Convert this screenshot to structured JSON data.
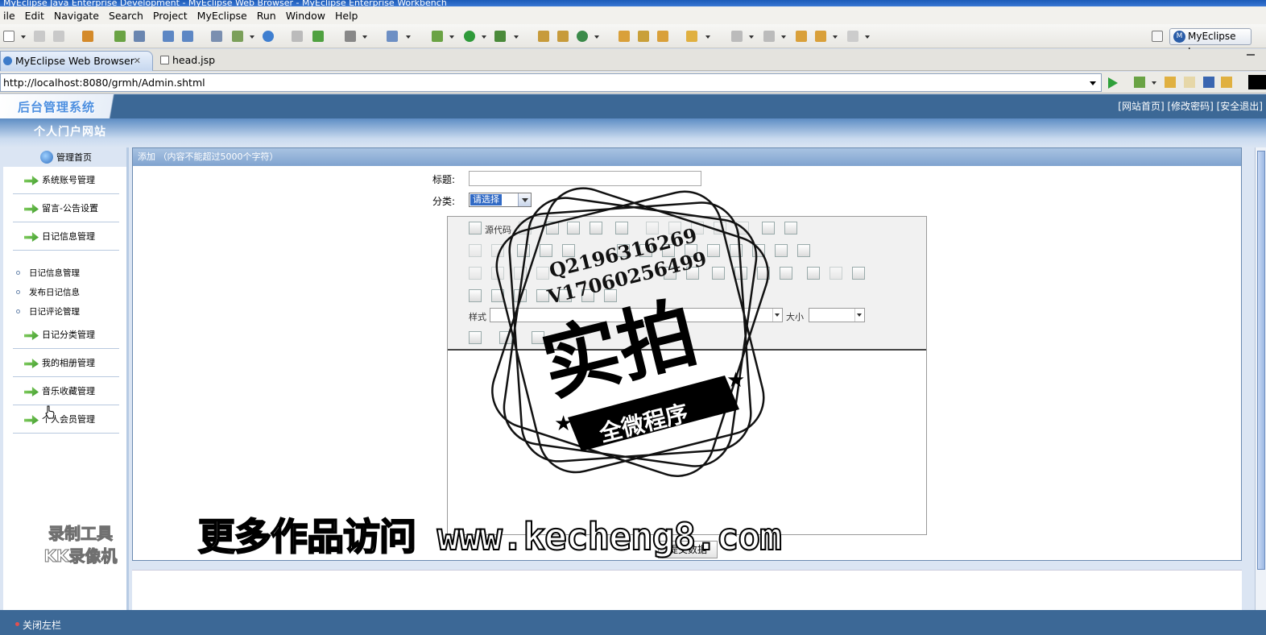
{
  "window": {
    "title": "MyEclipse Java Enterprise Development - MyEclipse Web Browser - MyEclipse Enterprise Workbench"
  },
  "menu": [
    "ile",
    "Edit",
    "Navigate",
    "Search",
    "Project",
    "MyEclipse",
    "Run",
    "Window",
    "Help"
  ],
  "perspective": {
    "label": "MyEclipse J..."
  },
  "tabs": [
    {
      "label": "MyEclipse Web Browser",
      "active": true
    },
    {
      "label": "head.jsp",
      "active": false
    }
  ],
  "address": {
    "url": "http://localhost:8080/grmh/Admin.shtml"
  },
  "site": {
    "logo": "后台管理系统",
    "name": "个人门户网站",
    "top_links": "[网站首页] [修改密码] [安全退出]"
  },
  "sidebar": {
    "home": "管理首页",
    "items": [
      "系统账号管理",
      "留言-公告设置",
      "日记信息管理",
      "日记分类管理",
      "我的相册管理",
      "音乐收藏管理",
      "个人会员管理"
    ],
    "sub_items": [
      "日记信息管理",
      "发布日记信息",
      "日记评论管理"
    ],
    "close_label": "关闭左栏"
  },
  "form": {
    "header": "添加 （内容不能超过5000个字符）",
    "title_label": "标题:",
    "title_value": "",
    "category_label": "分类:",
    "category_selected": "请选择",
    "submit_label": "提交数据"
  },
  "editor": {
    "source_label": "源代码",
    "style_label": "样式",
    "size_label": "大小"
  },
  "overlay": {
    "qq": "Q2196316269",
    "wx": "V17060256499",
    "stamp_main": "实拍",
    "stamp_sub": "全微程序",
    "banner": "更多作品访问 www.kecheng8.com",
    "recorder_line1": "录制工具",
    "recorder_line2": "KK录像机"
  },
  "colors": {
    "header_blue": "#3c6896",
    "page_bg": "#dbe5f3",
    "select_highlight": "#316ac5"
  }
}
